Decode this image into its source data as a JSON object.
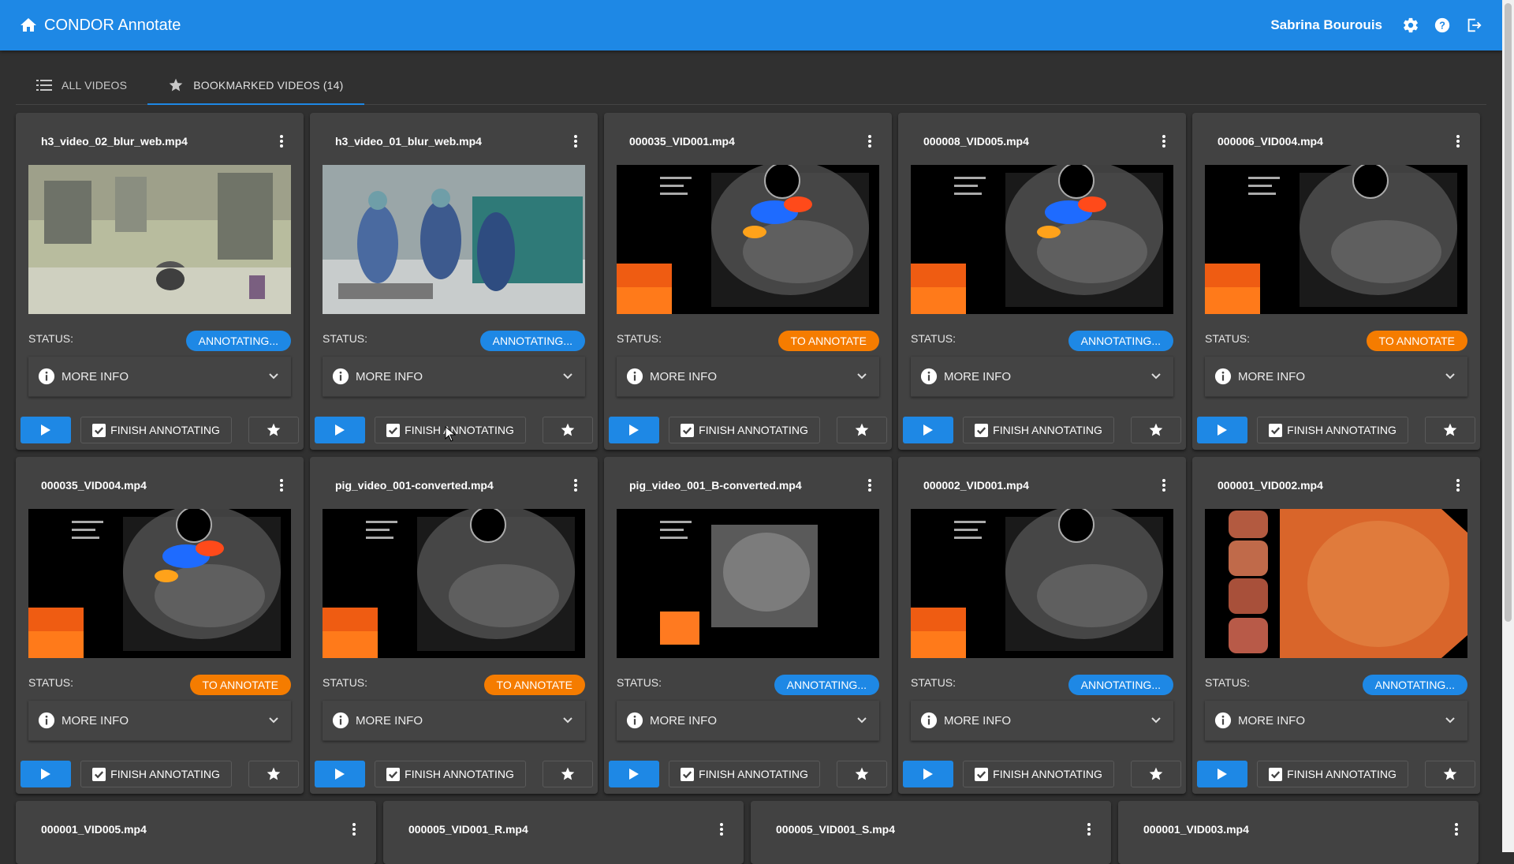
{
  "app": {
    "title": "CONDOR Annotate",
    "user": "Sabrina Bourouis"
  },
  "tabs": [
    {
      "label": "ALL VIDEOS",
      "icon": "list-icon"
    },
    {
      "label": "BOOKMARKED VIDEOS (14)",
      "icon": "star-icon"
    }
  ],
  "labels": {
    "status": "STATUS:",
    "more_info": "MORE INFO",
    "finish": "FINISH ANNOTATING"
  },
  "colors": {
    "appbar": "#1e88e5",
    "annotating": "#1e88e5",
    "to_annotate": "#f57c00",
    "background": "#303030",
    "card": "#424242"
  },
  "videos": [
    {
      "name": "h3_video_02_blur_web.mp4",
      "status": "ANNOTATING...",
      "thumb": "operating-room"
    },
    {
      "name": "h3_video_01_blur_web.mp4",
      "status": "ANNOTATING...",
      "thumb": "surgery-team"
    },
    {
      "name": "000035_VID001.mp4",
      "status": "TO ANNOTATE",
      "thumb": "ultrasound-doppler"
    },
    {
      "name": "000008_VID005.mp4",
      "status": "ANNOTATING...",
      "thumb": "ultrasound-doppler"
    },
    {
      "name": "000006_VID004.mp4",
      "status": "TO ANNOTATE",
      "thumb": "ultrasound"
    },
    {
      "name": "000035_VID004.mp4",
      "status": "TO ANNOTATE",
      "thumb": "ultrasound-doppler"
    },
    {
      "name": "pig_video_001-converted.mp4",
      "status": "TO ANNOTATE",
      "thumb": "ultrasound"
    },
    {
      "name": "pig_video_001_B-converted.mp4",
      "status": "ANNOTATING...",
      "thumb": "ultrasound-small"
    },
    {
      "name": "000002_VID001.mp4",
      "status": "ANNOTATING...",
      "thumb": "ultrasound"
    },
    {
      "name": "000001_VID002.mp4",
      "status": "ANNOTATING...",
      "thumb": "endoscopy"
    }
  ],
  "videos_row3": [
    {
      "name": "000001_VID005.mp4"
    },
    {
      "name": "000005_VID001_R.mp4"
    },
    {
      "name": "000005_VID001_S.mp4"
    },
    {
      "name": "000001_VID003.mp4"
    }
  ]
}
